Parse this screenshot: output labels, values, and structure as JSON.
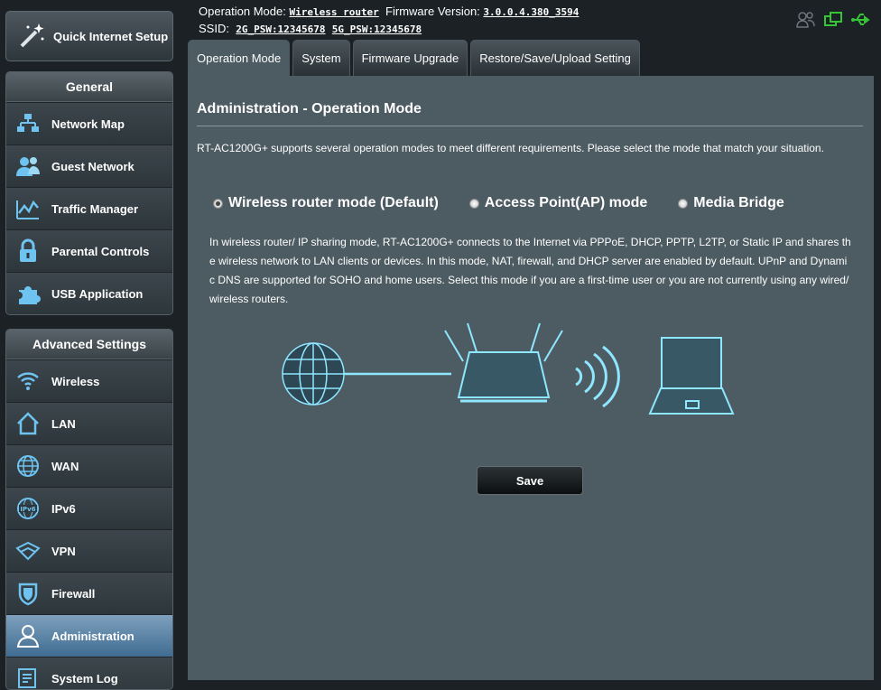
{
  "sidebar": {
    "qis_label": "Quick Internet Setup",
    "general": {
      "title": "General",
      "items": [
        {
          "label": "Network Map",
          "icon": "network-map-icon"
        },
        {
          "label": "Guest Network",
          "icon": "guest-network-icon"
        },
        {
          "label": "Traffic Manager",
          "icon": "traffic-manager-icon"
        },
        {
          "label": "Parental Controls",
          "icon": "parental-controls-icon"
        },
        {
          "label": "USB Application",
          "icon": "usb-application-icon"
        }
      ]
    },
    "advanced": {
      "title": "Advanced Settings",
      "items": [
        {
          "label": "Wireless",
          "icon": "wireless-icon"
        },
        {
          "label": "LAN",
          "icon": "lan-icon"
        },
        {
          "label": "WAN",
          "icon": "wan-icon"
        },
        {
          "label": "IPv6",
          "icon": "ipv6-icon"
        },
        {
          "label": "VPN",
          "icon": "vpn-icon"
        },
        {
          "label": "Firewall",
          "icon": "firewall-icon"
        },
        {
          "label": "Administration",
          "icon": "administration-icon",
          "active": true
        },
        {
          "label": "System Log",
          "icon": "system-log-icon"
        }
      ]
    }
  },
  "header": {
    "op_mode_label": "Operation Mode:",
    "op_mode_value": "Wireless router",
    "fw_label": "Firmware Version:",
    "fw_value": "3.0.0.4.380_3594",
    "ssid_label": "SSID:",
    "ssid_2g": "2G_PSW:12345678",
    "ssid_5g": "5G_PSW:12345678"
  },
  "tabs": [
    {
      "label": "Operation Mode",
      "active": true
    },
    {
      "label": "System"
    },
    {
      "label": "Firmware Upgrade"
    },
    {
      "label": "Restore/Save/Upload Setting"
    }
  ],
  "main": {
    "title": "Administration - Operation Mode",
    "description": "RT-AC1200G+ supports several operation modes to meet different requirements. Please select the mode that match your situation.",
    "modes": [
      {
        "label": "Wireless router mode (Default)",
        "checked": true
      },
      {
        "label": "Access Point(AP) mode",
        "checked": false
      },
      {
        "label": "Media Bridge",
        "checked": false
      }
    ],
    "mode_description": "In wireless router/ IP sharing mode, RT-AC1200G+ connects to the Internet via PPPoE, DHCP, PPTP, L2TP, or Static IP and shares the wireless network to LAN clients or devices. In this mode, NAT, firewall, and DHCP server are enabled by default. UPnP and Dynamic DNS are supported for SOHO and home users. Select this mode if you are a first-time user or you are not currently using any wired/wireless routers.",
    "save_label": "Save"
  },
  "colors": {
    "accent": "#7fe0ff",
    "active": "#3f6c91",
    "status_green": "#35c635"
  }
}
